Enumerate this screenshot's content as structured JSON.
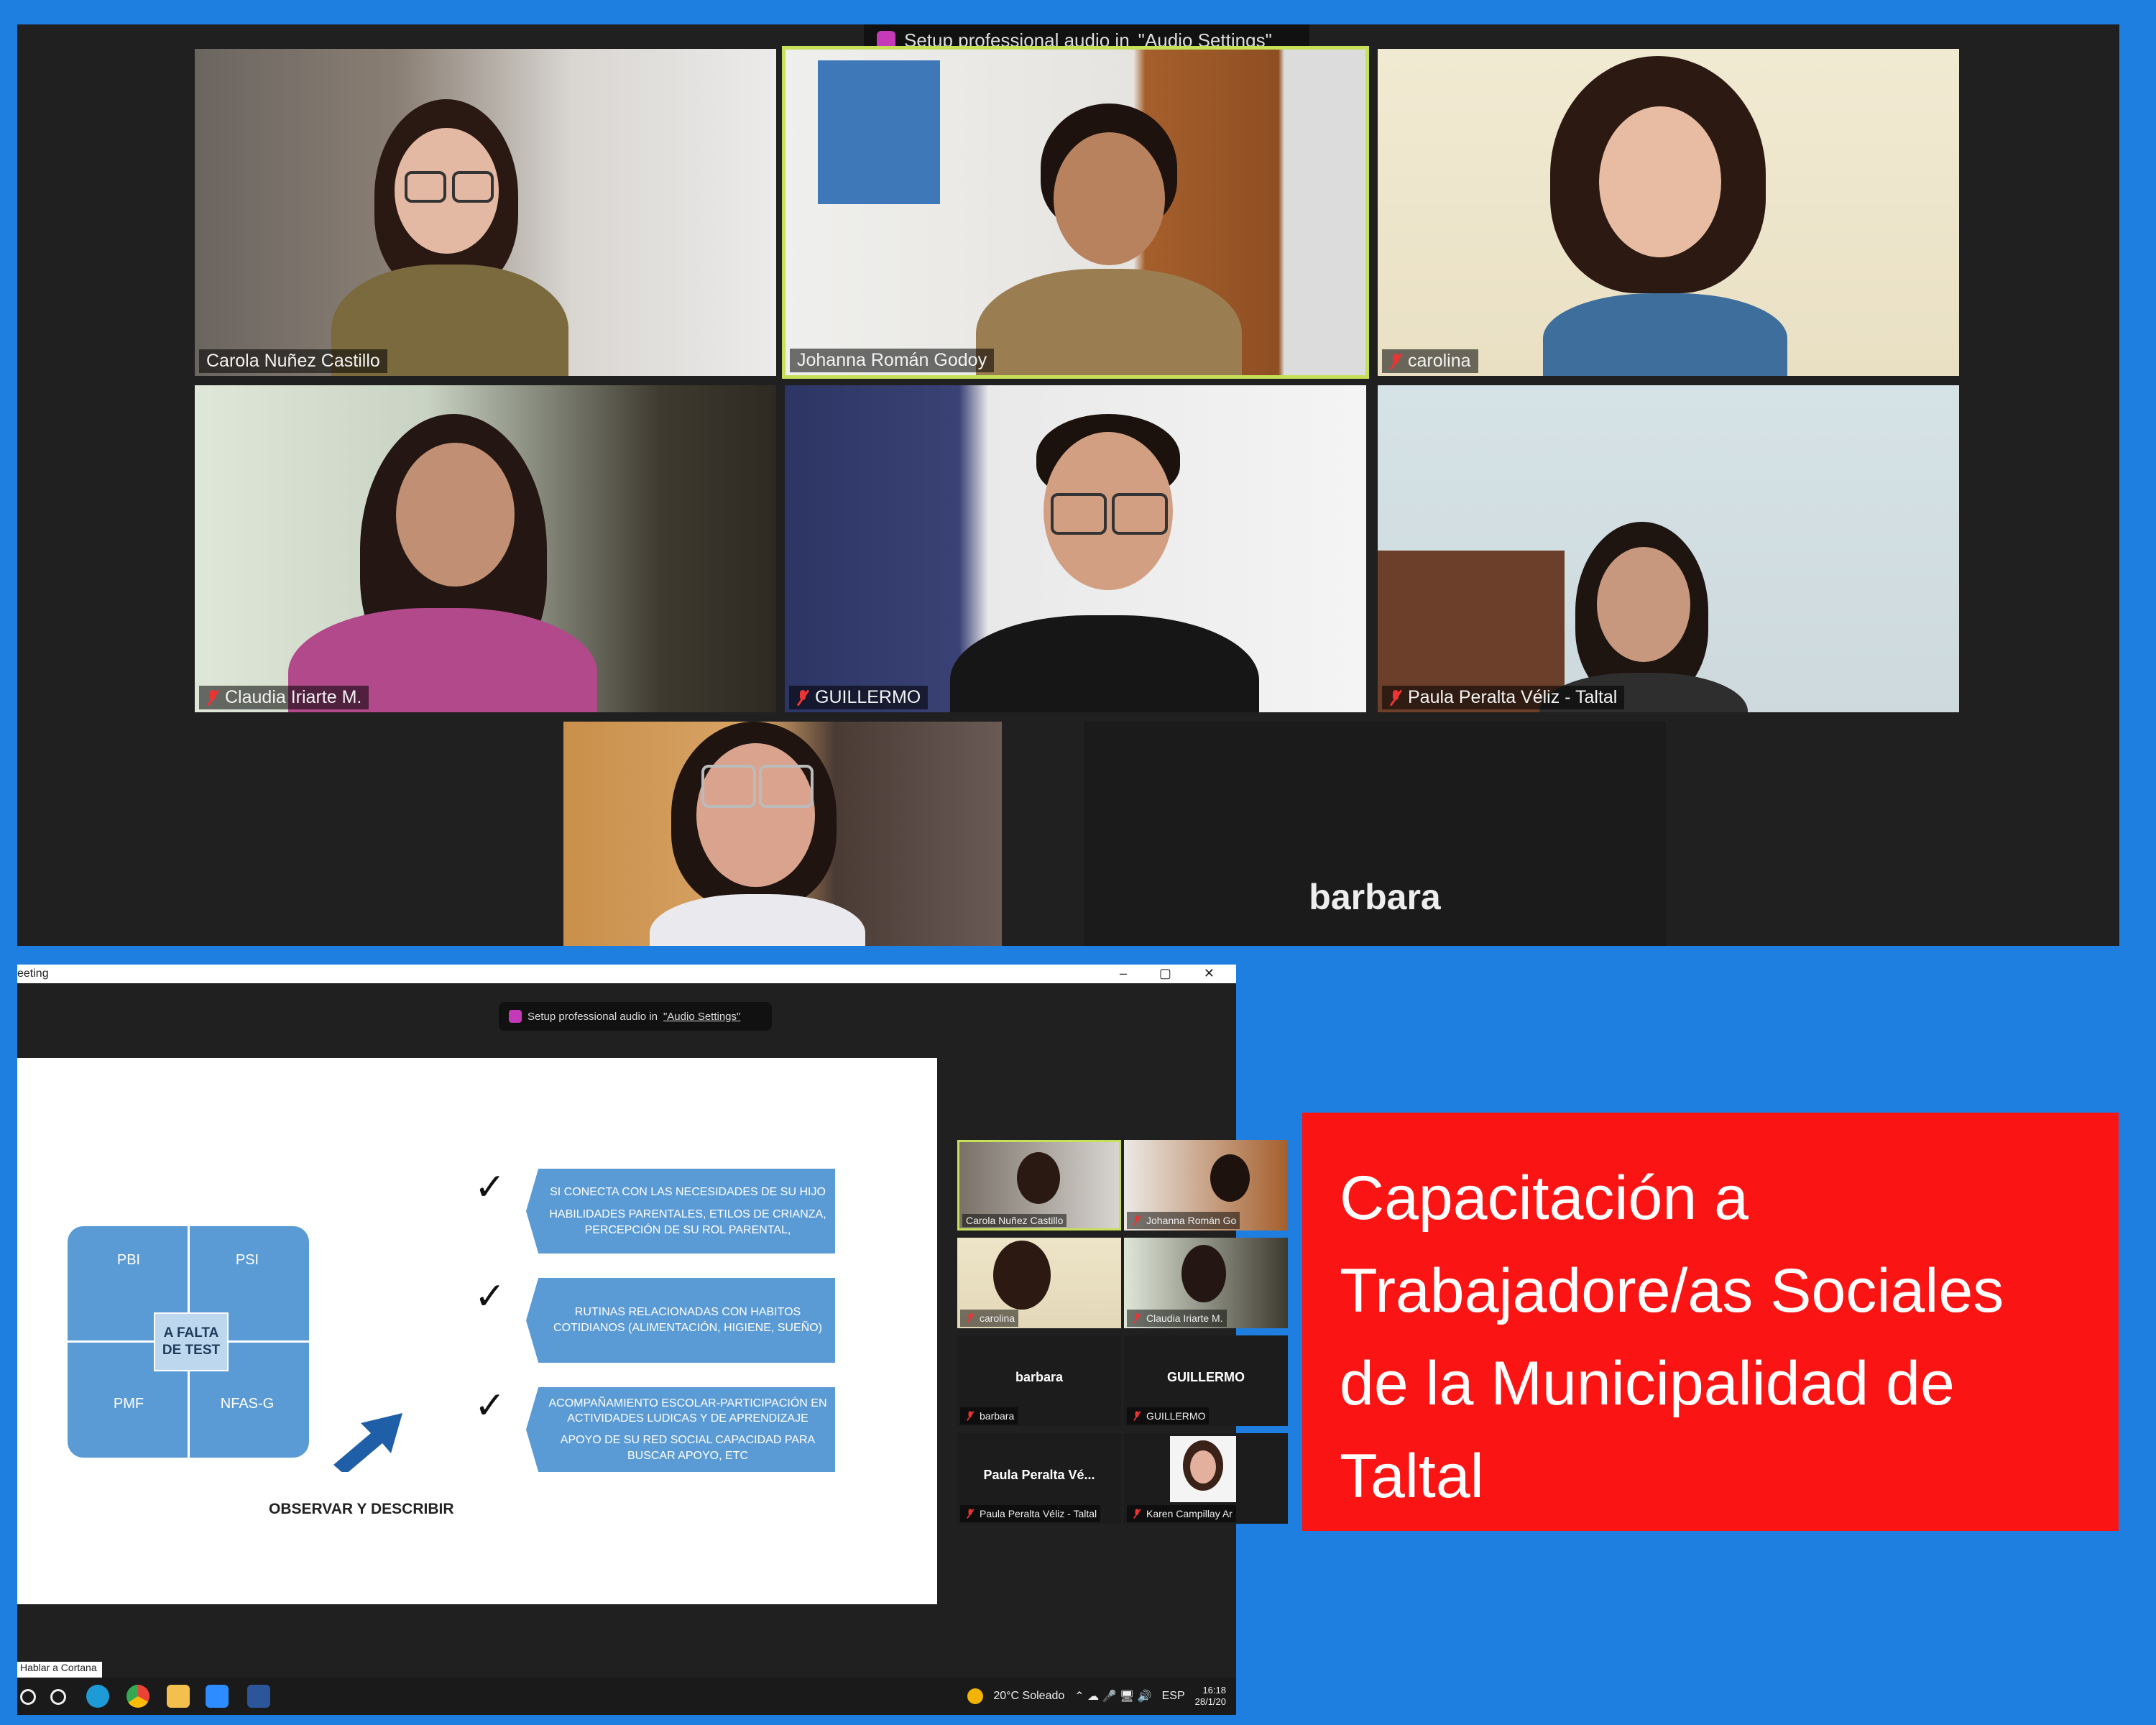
{
  "colors": {
    "background": "#1e7fe0",
    "caption_box": "#fb1414",
    "slide_accent": "#5b9bd5",
    "active_speaker_border": "#c7e05a"
  },
  "top_gallery": {
    "banner": {
      "text": "Setup professional audio in ",
      "link": "\"Audio Settings\""
    },
    "participants": [
      {
        "name": "Carola Nuñez Castillo",
        "muted": false,
        "active_speaker": false
      },
      {
        "name": "Johanna Román Godoy",
        "muted": false,
        "active_speaker": true
      },
      {
        "name": "carolina",
        "muted": true,
        "active_speaker": false
      },
      {
        "name": "Claudia Iriarte M.",
        "muted": true,
        "active_speaker": false
      },
      {
        "name": "GUILLERMO",
        "muted": true,
        "active_speaker": false
      },
      {
        "name": "Paula Peralta Véliz - Taltal",
        "muted": true,
        "active_speaker": false
      },
      {
        "name": "",
        "muted": false,
        "active_speaker": false
      },
      {
        "name": "barbara",
        "muted": false,
        "video_off": true
      }
    ]
  },
  "bottom_window": {
    "title": "eeting",
    "controls": "–  ▢  ✕",
    "banner": {
      "text": "Setup professional audio in ",
      "link": "\"Audio Settings\""
    },
    "slide": {
      "grid": [
        "PBI",
        "PSI",
        "PMF",
        "NFAS-G"
      ],
      "center": "A FALTA DE TEST",
      "footer": "OBSERVAR Y DESCRIBIR",
      "checkmark": "✓",
      "items": [
        {
          "line1": "SI CONECTA CON LAS NECESIDADES DE SU HIJO",
          "line2": "HABILIDADES PARENTALES, ETILOS DE CRIANZA, PERCEPCIÓN DE SU ROL PARENTAL,"
        },
        {
          "line1": "RUTINAS RELACIONADAS CON HABITOS COTIDIANOS (ALIMENTACIÓN, HIGIENE, SUEÑO)",
          "line2": ""
        },
        {
          "line1": "ACOMPAÑAMIENTO ESCOLAR-PARTICIPACIÓN EN ACTIVIDADES LUDICAS Y DE APRENDIZAJE",
          "line2": "APOYO DE SU RED SOCIAL CAPACIDAD PARA BUSCAR APOYO, ETC"
        }
      ]
    },
    "thumbnails": [
      {
        "name": "Carola Nuñez Castillo",
        "big": "",
        "video": true,
        "muted": false
      },
      {
        "name": "Johanna Román Go",
        "big": "",
        "video": true,
        "muted": true
      },
      {
        "name": "carolina",
        "big": "",
        "video": true,
        "muted": true
      },
      {
        "name": "Claudia Iriarte M.",
        "big": "",
        "video": true,
        "muted": true
      },
      {
        "name": "barbara",
        "big": "barbara",
        "video": false,
        "muted": true
      },
      {
        "name": "GUILLERMO",
        "big": "GUILLERMO",
        "video": false,
        "muted": true
      },
      {
        "name": "Paula Peralta Véliz - Taltal",
        "big": "Paula Peralta Vé...",
        "video": false,
        "muted": true
      },
      {
        "name": "Karen Campillay Ar",
        "big": "",
        "video": true,
        "muted": true
      }
    ],
    "taskbar": {
      "cortana_tooltip": "Hablar a Cortana",
      "weather": "20°C  Soleado",
      "language": "ESP",
      "time": "16:18",
      "date": "28/1/20"
    }
  },
  "caption": {
    "line1": "Capacitación a",
    "line2": "Trabajadore/as Sociales",
    "line3": "de la Municipalidad de",
    "line4": "Taltal"
  }
}
